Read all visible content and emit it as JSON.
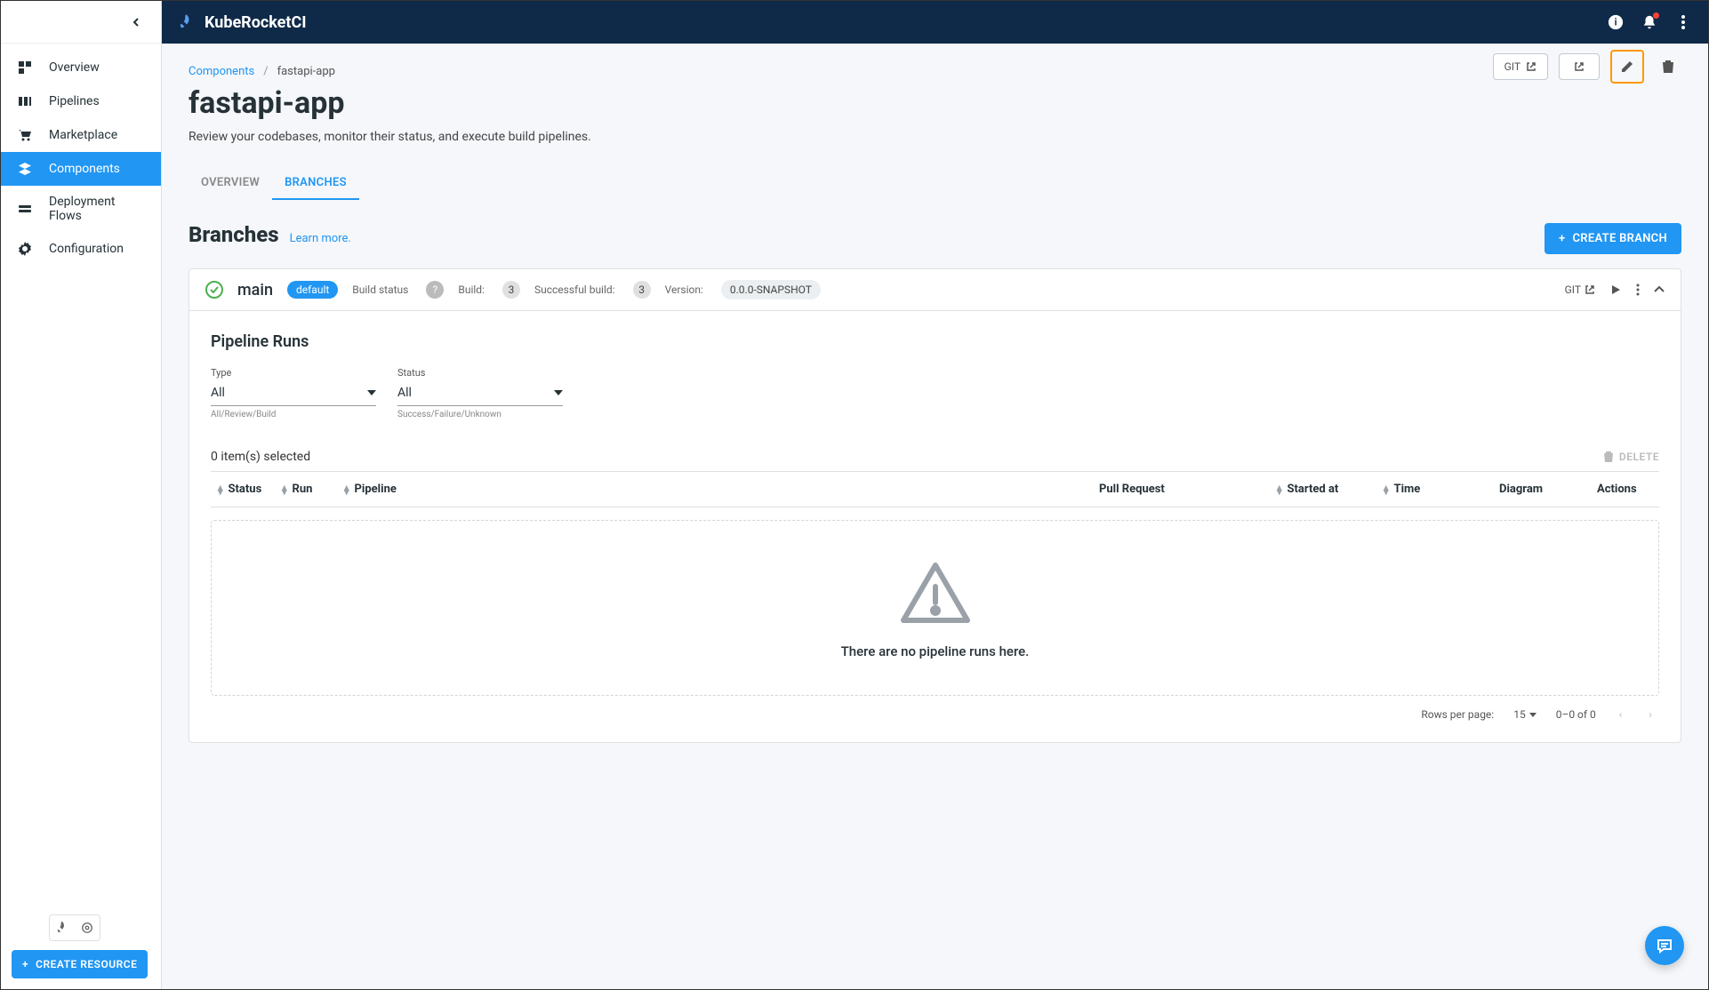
{
  "brand": "KubeRocketCI",
  "sidebar": {
    "items": [
      {
        "label": "Overview",
        "icon": "dashboard-icon"
      },
      {
        "label": "Pipelines",
        "icon": "pipelines-icon"
      },
      {
        "label": "Marketplace",
        "icon": "cart-icon"
      },
      {
        "label": "Components",
        "icon": "layers-icon"
      },
      {
        "label": "Deployment Flows",
        "icon": "flows-icon"
      },
      {
        "label": "Configuration",
        "icon": "gear-icon"
      }
    ],
    "create_resource": "CREATE RESOURCE"
  },
  "breadcrumb": {
    "root": "Components",
    "current": "fastapi-app"
  },
  "page": {
    "title": "fastapi-app",
    "description": "Review your codebases, monitor their status, and execute build pipelines.",
    "git_btn": "GIT"
  },
  "tabs": [
    {
      "label": "OVERVIEW",
      "active": false
    },
    {
      "label": "BRANCHES",
      "active": true
    }
  ],
  "section": {
    "title": "Branches",
    "learn_more": "Learn more.",
    "create_btn": "CREATE BRANCH"
  },
  "branch": {
    "name": "main",
    "chip": "default",
    "build_status_label": "Build status",
    "build_label": "Build:",
    "build_count": "3",
    "success_label": "Successful build:",
    "success_count": "3",
    "version_label": "Version:",
    "version": "0.0.0-SNAPSHOT",
    "git_label": "GIT"
  },
  "pipeline_runs": {
    "title": "Pipeline Runs",
    "filters": {
      "type": {
        "label": "Type",
        "value": "All",
        "help": "All/Review/Build"
      },
      "status": {
        "label": "Status",
        "value": "All",
        "help": "Success/Failure/Unknown"
      }
    },
    "selection": "0 item(s) selected",
    "delete": "DELETE",
    "columns": [
      "Status",
      "Run",
      "Pipeline",
      "Pull Request",
      "Started at",
      "Time",
      "Diagram",
      "Actions"
    ],
    "empty": "There are no pipeline runs here.",
    "pagination": {
      "rows_label": "Rows per page:",
      "rows": "15",
      "range": "0–0 of 0"
    }
  }
}
